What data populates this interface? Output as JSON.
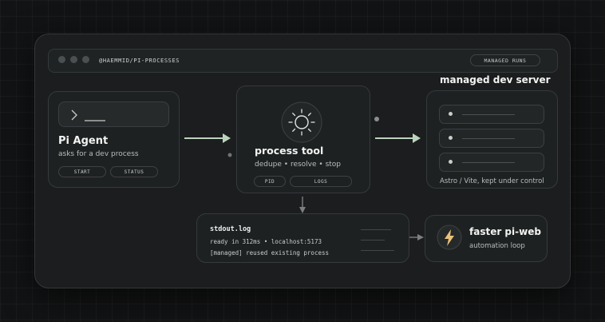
{
  "window": {
    "repo_label": "@HAEMMID/PI-PROCESSES",
    "badge_label": "MANAGED RUNS"
  },
  "agent": {
    "title": "Pi Agent",
    "subtitle": "asks for a dev process",
    "buttons": [
      "START",
      "STATUS"
    ]
  },
  "process_tool": {
    "title": "process tool",
    "subtitle": "dedupe • resolve • stop",
    "buttons": [
      "PID",
      "LOGS"
    ],
    "icon": "sun-icon"
  },
  "dev_server": {
    "heading": "managed dev server",
    "caption": "Astro / Vite, kept under control",
    "rows": 3
  },
  "log": {
    "filename": "stdout.log",
    "lines": [
      "ready in 312ms • localhost:5173",
      "[managed] reused existing process"
    ]
  },
  "pi_web": {
    "title": "faster pi-web",
    "subtitle": "automation loop",
    "icon": "lightning-icon",
    "icon_color": "#e8c27a"
  },
  "colors": {
    "accent_arrow": "#bcd3bd",
    "background": "#121314",
    "card": "#1e2122"
  }
}
